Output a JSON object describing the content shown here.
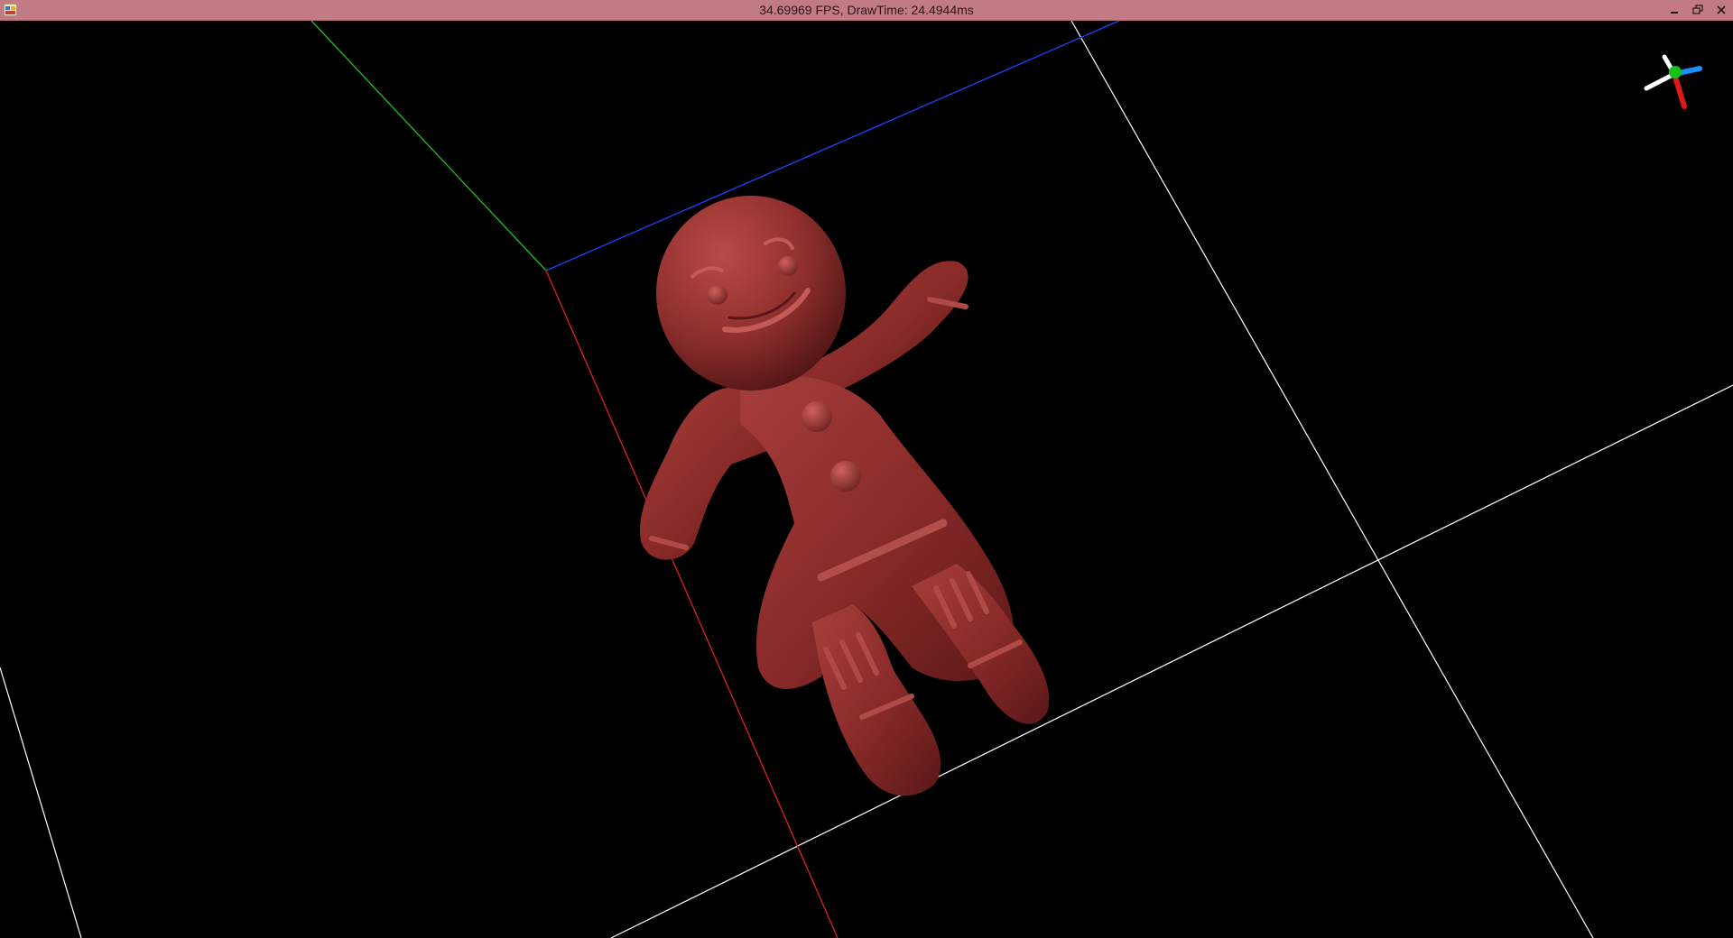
{
  "window": {
    "title": "34.69969 FPS, DrawTime: 24.4944ms"
  },
  "controls": {
    "minimize": "minimize",
    "restore": "restore",
    "close": "close"
  },
  "scene": {
    "model": "gingerbread-man",
    "model_color": "#8b2e2e",
    "axis_colors": {
      "x": "#e02020",
      "y": "#20c020",
      "z": "#2040ff"
    },
    "grid_color": "#ffffff",
    "background": "#000000"
  },
  "gizmo": {
    "icon": "orientation-gizmo-icon",
    "colors": {
      "x": "#e01818",
      "y": "#18c018",
      "z": "#1890ff",
      "neg": "#ffffff"
    }
  }
}
